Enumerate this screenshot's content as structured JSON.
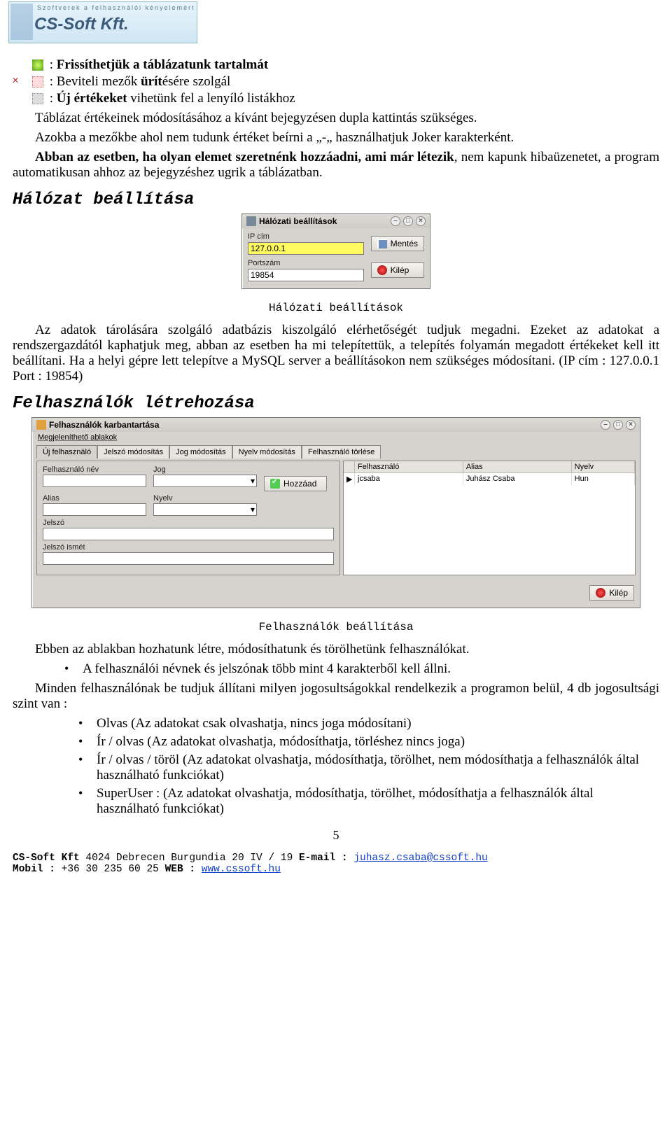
{
  "logo": {
    "tagline": "Szoftverek a felhasználói kényelemért",
    "brand": "CS-Soft Kft."
  },
  "intro": {
    "items": [
      {
        "label_prefix": ": ",
        "label": "Frissíthetjük a táblázatunk tartalmát"
      },
      {
        "label_prefix": ": Beviteli mezők ",
        "label_bold": "ürít",
        "label_suffix": "ésére szolgál"
      },
      {
        "label_prefix": ": ",
        "label_bold": "Új értékeket",
        "label_suffix": " vihetünk fel a lenyíló listákhoz"
      }
    ],
    "para1": "Táblázat értékeinek módosításához a kívánt bejegyzésen dupla kattintás szükséges.",
    "para2": "Azokba a mezőkbe ahol nem tudunk értéket beírni a „-„ használhatjuk Joker karakterként.",
    "para3_lead": "Abban az esetben, ha olyan elemet szeretnénk hozzáadni, ami már létezik",
    "para3_rest": ", nem kapunk hibaüzenetet, a program automatikusan ahhoz az bejegyzéshez ugrik a táblázatban."
  },
  "section1": {
    "heading": "Hálózat beállítása",
    "window": {
      "title": "Hálózati beállítások",
      "ip_label": "IP cím",
      "ip_value": "127.0.0.1",
      "port_label": "Portszám",
      "port_value": "19854",
      "save": "Mentés",
      "exit": "Kilép"
    },
    "caption": "Hálózati beállítások",
    "para": "Az adatok tárolására szolgáló adatbázis kiszolgáló elérhetőségét tudjuk megadni. Ezeket az adatokat a rendszergazdától kaphatjuk meg, abban az esetben ha mi telepítettük, a telepítés folyamán megadott értékeket kell itt beállítani. Ha a helyi gépre lett telepítve a MySQL server a beállításokon nem szükséges módosítani. (IP cím : 127.0.0.1 Port : 19854)"
  },
  "section2": {
    "heading": "Felhasználók létrehozása",
    "window": {
      "title": "Felhasználók karbantartása",
      "menu": "Megjeleníthető ablakok",
      "tabs": [
        "Új felhasználó",
        "Jelszó módosítás",
        "Jog módosítás",
        "Nyelv módosítás",
        "Felhasználó törlése"
      ],
      "form": {
        "f_user": "Felhasználó név",
        "f_jog": "Jog",
        "f_alias": "Alias",
        "f_nyelv": "Nyelv",
        "f_jelszo": "Jelszó",
        "f_jelszo2": "Jelszó ismét",
        "add": "Hozzáad"
      },
      "grid": {
        "cols": [
          "Felhasználó",
          "Alias",
          "Nyelv"
        ],
        "row": {
          "user": "jcsaba",
          "alias": "Juhász Csaba",
          "nyelv": "Hun"
        }
      },
      "exit": "Kilép"
    },
    "caption": "Felhasználók beállítása",
    "para1": "Ebben az ablakban hozhatunk létre, módosíthatunk és törölhetünk felhasználókat.",
    "bullet_lead": "A felhasználói névnek és jelszónak több mint 4 karakterből kell állni.",
    "para2": "Minden felhasználónak be tudjuk állítani milyen jogosultságokkal rendelkezik a programon belül, 4 db jogosultsági szint van :",
    "rights": [
      "Olvas (Az adatokat csak olvashatja, nincs joga módosítani)",
      "Ír / olvas (Az adatokat olvashatja, módosíthatja, törléshez nincs joga)",
      "Ír / olvas / töröl (Az adatokat olvashatja, módosíthatja, törölhet, nem módosíthatja a felhasználók által használható funkciókat)",
      "SuperUser : (Az adatokat olvashatja, módosíthatja, törölhet, módosíthatja a felhasználók által használható funkciókat)"
    ]
  },
  "page_number": "5",
  "footer": {
    "line1_a": "CS-Soft Kft",
    "line1_b": " 4024 Debrecen Burgundia 20 IV / 19 ",
    "line1_c": "E-mail : ",
    "email": "juhasz.csaba@cssoft.hu",
    "line2_a": "Mobil :",
    "line2_b": " +36 30 235 60 25 ",
    "line2_c": "WEB : ",
    "web": "www.cssoft.hu"
  }
}
